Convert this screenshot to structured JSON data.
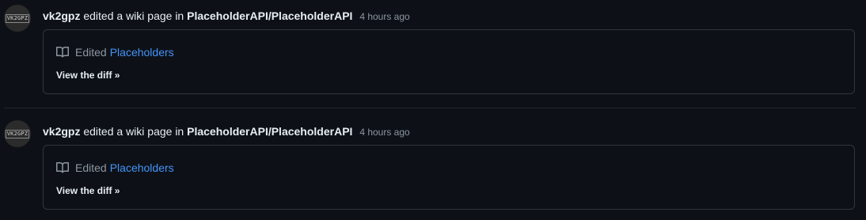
{
  "events": [
    {
      "avatar_text": "VK2GPZ",
      "actor": "vk2gpz",
      "action": "edited a wiki page in",
      "repo": "PlaceholderAPI/PlaceholderAPI",
      "time": "4 hours ago",
      "edited_label": "Edited",
      "page_name": "Placeholders",
      "diff_link": "View the diff »",
      "icon": "book-icon"
    },
    {
      "avatar_text": "VK2GPZ",
      "actor": "vk2gpz",
      "action": "edited a wiki page in",
      "repo": "PlaceholderAPI/PlaceholderAPI",
      "time": "4 hours ago",
      "edited_label": "Edited",
      "page_name": "Placeholders",
      "diff_link": "View the diff »",
      "icon": "book-icon"
    }
  ],
  "colors": {
    "background": "#0d1117",
    "border": "#30363d",
    "link": "#4493f8",
    "muted": "#8d96a0"
  }
}
